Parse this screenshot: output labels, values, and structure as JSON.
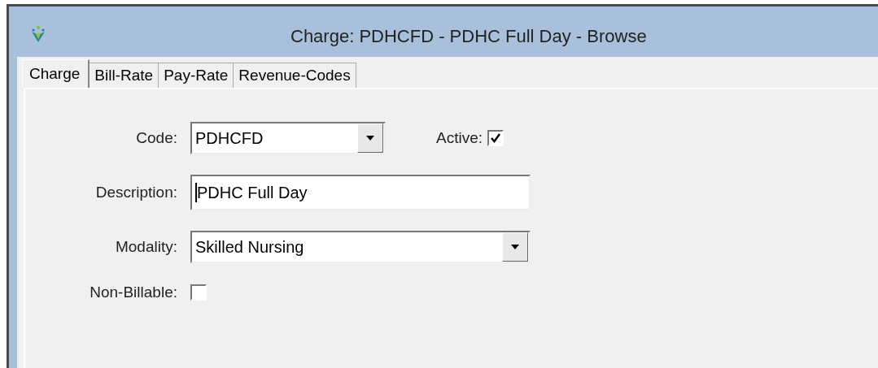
{
  "window": {
    "title": "Charge: PDHCFD - PDHC Full Day - Browse"
  },
  "tabs": [
    {
      "label": "Charge",
      "selected": true
    },
    {
      "label": "Bill-Rate",
      "selected": false
    },
    {
      "label": "Pay-Rate",
      "selected": false
    },
    {
      "label": "Revenue-Codes",
      "selected": false
    }
  ],
  "form": {
    "code": {
      "label": "Code:",
      "value": "PDHCFD"
    },
    "active": {
      "label": "Active:",
      "checked": true
    },
    "description": {
      "label": "Description:",
      "value": "PDHC Full Day"
    },
    "modality": {
      "label": "Modality:",
      "value": "Skilled Nursing"
    },
    "non_billable": {
      "label": "Non-Billable:",
      "checked": false
    }
  }
}
